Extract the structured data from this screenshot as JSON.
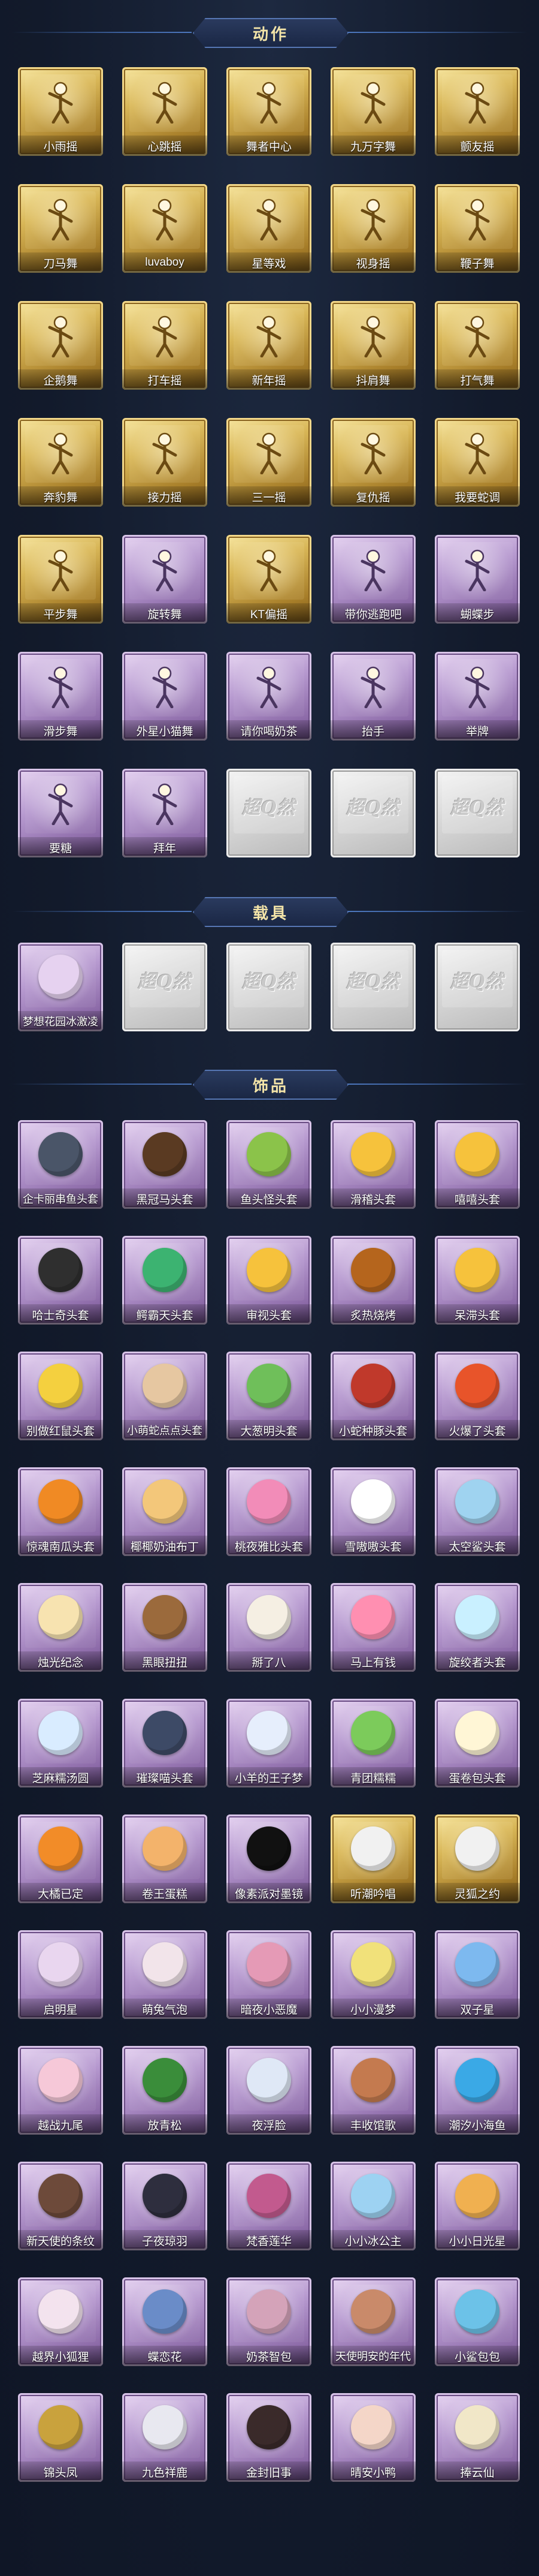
{
  "sections": {
    "actions": {
      "title": "动作"
    },
    "vehicles": {
      "title": "载具"
    },
    "accessories": {
      "title": "饰品"
    }
  },
  "colors": {
    "background": "#11192a",
    "header_text": "#f3e4a8",
    "gold_card": "#d8b657",
    "purple_card": "#b79ad0",
    "silver_card": "#d8d8d8"
  },
  "placeholder_logo": "超Q然",
  "actions": [
    {
      "label": "小雨摇",
      "tier": "gold",
      "icon": "pose-icon"
    },
    {
      "label": "心跳摇",
      "tier": "gold",
      "icon": "pose-icon"
    },
    {
      "label": "舞者中心",
      "tier": "gold",
      "icon": "pose-icon"
    },
    {
      "label": "九万字舞",
      "tier": "gold",
      "icon": "pose-icon"
    },
    {
      "label": "颤友摇",
      "tier": "gold",
      "icon": "pose-icon"
    },
    {
      "label": "刀马舞",
      "tier": "gold",
      "icon": "pose-icon"
    },
    {
      "label": "luvaboy",
      "tier": "gold",
      "icon": "pose-icon"
    },
    {
      "label": "星等戏",
      "tier": "gold",
      "icon": "pose-icon"
    },
    {
      "label": "视身摇",
      "tier": "gold",
      "icon": "pose-icon"
    },
    {
      "label": "鞭子舞",
      "tier": "gold",
      "icon": "pose-icon"
    },
    {
      "label": "企鹅舞",
      "tier": "gold",
      "icon": "pose-icon"
    },
    {
      "label": "打车摇",
      "tier": "gold",
      "icon": "pose-icon"
    },
    {
      "label": "新年摇",
      "tier": "gold",
      "icon": "pose-icon"
    },
    {
      "label": "抖肩舞",
      "tier": "gold",
      "icon": "pose-icon"
    },
    {
      "label": "打气舞",
      "tier": "gold",
      "icon": "pose-icon"
    },
    {
      "label": "奔豹舞",
      "tier": "gold",
      "icon": "pose-icon"
    },
    {
      "label": "接力摇",
      "tier": "gold",
      "icon": "pose-icon"
    },
    {
      "label": "三一摇",
      "tier": "gold",
      "icon": "pose-icon"
    },
    {
      "label": "复仇摇",
      "tier": "gold",
      "icon": "pose-icon"
    },
    {
      "label": "我要蛇调",
      "tier": "gold",
      "icon": "pose-icon"
    },
    {
      "label": "平步舞",
      "tier": "gold",
      "icon": "pose-icon"
    },
    {
      "label": "旋转舞",
      "tier": "purple",
      "icon": "pose-icon"
    },
    {
      "label": "KT偏摇",
      "tier": "gold",
      "icon": "pose-icon"
    },
    {
      "label": "带你逃跑吧",
      "tier": "purple",
      "icon": "pose-icon"
    },
    {
      "label": "蝴蝶步",
      "tier": "purple",
      "icon": "pose-icon"
    },
    {
      "label": "滑步舞",
      "tier": "purple",
      "icon": "pose-icon"
    },
    {
      "label": "外星小猫舞",
      "tier": "purple",
      "icon": "pose-icon"
    },
    {
      "label": "请你喝奶茶",
      "tier": "purple",
      "icon": "pose-icon"
    },
    {
      "label": "抬手",
      "tier": "purple",
      "icon": "pose-icon"
    },
    {
      "label": "举牌",
      "tier": "purple",
      "icon": "pose-icon"
    },
    {
      "label": "要糖",
      "tier": "purple",
      "icon": "pose-icon"
    },
    {
      "label": "拜年",
      "tier": "purple",
      "icon": "pose-icon"
    },
    {
      "label": "",
      "tier": "silver",
      "icon": "placeholder-logo-icon"
    },
    {
      "label": "",
      "tier": "silver",
      "icon": "placeholder-logo-icon"
    },
    {
      "label": "",
      "tier": "silver",
      "icon": "placeholder-logo-icon"
    }
  ],
  "vehicles": [
    {
      "label": "梦想花园冰激凌",
      "tier": "purple",
      "icon": "ice-cream-truck-icon"
    },
    {
      "label": "",
      "tier": "silver",
      "icon": "placeholder-logo-icon"
    },
    {
      "label": "",
      "tier": "silver",
      "icon": "placeholder-logo-icon"
    },
    {
      "label": "",
      "tier": "silver",
      "icon": "placeholder-logo-icon"
    },
    {
      "label": "",
      "tier": "silver",
      "icon": "placeholder-logo-icon"
    }
  ],
  "accessories": [
    {
      "label": "企卡丽串鱼头套",
      "tier": "purple",
      "icon": "penguin-head-icon",
      "color": "#4a5568"
    },
    {
      "label": "黑冠马头套",
      "tier": "purple",
      "icon": "horse-head-icon",
      "color": "#5a3a22"
    },
    {
      "label": "鱼头怪头套",
      "tier": "purple",
      "icon": "fish-head-icon",
      "color": "#8bc34a"
    },
    {
      "label": "滑稽头套",
      "tier": "purple",
      "icon": "funny-face-icon",
      "color": "#f6c23c"
    },
    {
      "label": "嘻嘻头套",
      "tier": "purple",
      "icon": "grin-face-icon",
      "color": "#f6c23c"
    },
    {
      "label": "哈士奇头套",
      "tier": "purple",
      "icon": "husky-head-icon",
      "color": "#2f2f2f"
    },
    {
      "label": "鳄霸天头套",
      "tier": "purple",
      "icon": "crocodile-head-icon",
      "color": "#3cb371"
    },
    {
      "label": "审视头套",
      "tier": "purple",
      "icon": "stare-face-icon",
      "color": "#f6c23c"
    },
    {
      "label": "炙热烧烤",
      "tier": "purple",
      "icon": "bbq-face-icon",
      "color": "#b5651d"
    },
    {
      "label": "呆滞头套",
      "tier": "purple",
      "icon": "blank-face-icon",
      "color": "#f6c23c"
    },
    {
      "label": "别做红鼠头套",
      "tier": "purple",
      "icon": "pikachu-head-icon",
      "color": "#f4d03f"
    },
    {
      "label": "小萌蛇点点头套",
      "tier": "purple",
      "icon": "snake-head-icon",
      "color": "#e6c7a1"
    },
    {
      "label": "大葱明头套",
      "tier": "purple",
      "icon": "scallion-head-icon",
      "color": "#6fbf5a"
    },
    {
      "label": "小蛇种豚头套",
      "tier": "purple",
      "icon": "boar-head-icon",
      "color": "#c0392b"
    },
    {
      "label": "火爆了头套",
      "tier": "purple",
      "icon": "fire-face-icon",
      "color": "#e8542a"
    },
    {
      "label": "惊魂南瓜头套",
      "tier": "purple",
      "icon": "pumpkin-head-icon",
      "color": "#f08a24"
    },
    {
      "label": "椰椰奶油布丁",
      "tier": "purple",
      "icon": "pudding-head-icon",
      "color": "#f3c77a"
    },
    {
      "label": "桃夜雅比头套",
      "tier": "purple",
      "icon": "pink-monster-head-icon",
      "color": "#f28cb8"
    },
    {
      "label": "雪嗷嗷头套",
      "tier": "purple",
      "icon": "snow-head-icon",
      "color": "#ffffff"
    },
    {
      "label": "太空鲨头套",
      "tier": "purple",
      "icon": "shark-head-icon",
      "color": "#9fd3f0"
    },
    {
      "label": "烛光纪念",
      "tier": "purple",
      "icon": "candle-head-icon",
      "color": "#f7e3b0"
    },
    {
      "label": "黑眼扭扭",
      "tier": "purple",
      "icon": "dog-head-icon",
      "color": "#9b6a3c"
    },
    {
      "label": "掰了八",
      "tier": "purple",
      "icon": "dumpling-head-icon",
      "color": "#f5efe3"
    },
    {
      "label": "马上有钱",
      "tier": "purple",
      "icon": "money-head-icon",
      "color": "#ff8fb1"
    },
    {
      "label": "旋绞者头套",
      "tier": "purple",
      "icon": "cloud-head-icon",
      "color": "#c9f0ff"
    },
    {
      "label": "芝麻糯汤圆",
      "tier": "purple",
      "icon": "tangyuan-head-icon",
      "color": "#d9ecff"
    },
    {
      "label": "璀璨喵头套",
      "tier": "purple",
      "icon": "cat-head-icon",
      "color": "#3d4a66"
    },
    {
      "label": "小羊的王子梦",
      "tier": "purple",
      "icon": "sheep-head-icon",
      "color": "#e6eefc"
    },
    {
      "label": "青团糯糯",
      "tier": "purple",
      "icon": "qingtuan-head-icon",
      "color": "#7ccb5b"
    },
    {
      "label": "蛋卷包头套",
      "tier": "purple",
      "icon": "egg-crown-head-icon",
      "color": "#fff6d6"
    },
    {
      "label": "大橘已定",
      "tier": "purple",
      "icon": "orange-face-icon",
      "color": "#f28c28"
    },
    {
      "label": "卷王蛋糕",
      "tier": "purple",
      "icon": "cake-roll-icon",
      "color": "#f3b36b"
    },
    {
      "label": "像素派对墨镜",
      "tier": "purple",
      "icon": "pixel-sunglasses-icon",
      "color": "#111111"
    },
    {
      "label": "听潮吟唱",
      "tier": "gold",
      "icon": "mask-icon",
      "color": "#f1f1f1"
    },
    {
      "label": "灵狐之约",
      "tier": "gold",
      "icon": "fox-mask-icon",
      "color": "#f1f1f1"
    },
    {
      "label": "启明星",
      "tier": "purple",
      "icon": "star-hair-icon",
      "color": "#e9d6ef"
    },
    {
      "label": "萌兔气泡",
      "tier": "purple",
      "icon": "bunny-hair-icon",
      "color": "#f2e4ea"
    },
    {
      "label": "暗夜小恶魔",
      "tier": "purple",
      "icon": "devil-icon",
      "color": "#e59ab6"
    },
    {
      "label": "小小漫梦",
      "tier": "purple",
      "icon": "sprout-icon",
      "color": "#f1e17a"
    },
    {
      "label": "双子星",
      "tier": "purple",
      "icon": "twin-star-icon",
      "color": "#7db9ef"
    },
    {
      "label": "越战九尾",
      "tier": "purple",
      "icon": "nine-tail-icon",
      "color": "#f6c8d8"
    },
    {
      "label": "放青松",
      "tier": "purple",
      "icon": "bonsai-icon",
      "color": "#3a8d3a"
    },
    {
      "label": "夜浮脸",
      "tier": "purple",
      "icon": "night-face-icon",
      "color": "#dfe8f6"
    },
    {
      "label": "丰收馆歌",
      "tier": "purple",
      "icon": "harvest-icon",
      "color": "#c47a4f"
    },
    {
      "label": "潮汐小海鱼",
      "tier": "purple",
      "icon": "sea-fish-icon",
      "color": "#3aa9e6"
    },
    {
      "label": "新天使的条纹",
      "tier": "purple",
      "icon": "angel-hair-icon",
      "color": "#6d4a3a"
    },
    {
      "label": "子夜琼羽",
      "tier": "purple",
      "icon": "feather-hair-icon",
      "color": "#2e2e3e"
    },
    {
      "label": "梵香莲华",
      "tier": "purple",
      "icon": "lotus-hair-icon",
      "color": "#c25a8e"
    },
    {
      "label": "小小冰公主",
      "tier": "purple",
      "icon": "ice-princess-icon",
      "color": "#9dd2f2"
    },
    {
      "label": "小小日光星",
      "tier": "purple",
      "icon": "sun-star-icon",
      "color": "#f0b050"
    },
    {
      "label": "越界小狐狸",
      "tier": "purple",
      "icon": "fox-icon",
      "color": "#f3e3ee"
    },
    {
      "label": "蝶恋花",
      "tier": "purple",
      "icon": "butterfly-icon",
      "color": "#6a8cc8"
    },
    {
      "label": "奶茶智包",
      "tier": "purple",
      "icon": "milk-tea-bag-icon",
      "color": "#d4a3b9"
    },
    {
      "label": "天使明安的年代",
      "tier": "purple",
      "icon": "angel-doll-icon",
      "color": "#c98a6a"
    },
    {
      "label": "小鲨包包",
      "tier": "purple",
      "icon": "shark-bag-icon",
      "color": "#6cc2e8"
    },
    {
      "label": "锦头凤",
      "tier": "purple",
      "icon": "phoenix-hair-icon",
      "color": "#c9a23d"
    },
    {
      "label": "九色祥鹿",
      "tier": "purple",
      "icon": "deer-icon",
      "color": "#e8e8f0"
    },
    {
      "label": "金封旧事",
      "tier": "purple",
      "icon": "doll-keychain-icon",
      "color": "#3a2a2a"
    },
    {
      "label": "晴安小鸭",
      "tier": "purple",
      "icon": "duck-keychain-icon",
      "color": "#f4d6c8"
    },
    {
      "label": "捧云仙",
      "tier": "purple",
      "icon": "cloud-fairy-icon",
      "color": "#f1e7c8"
    }
  ]
}
